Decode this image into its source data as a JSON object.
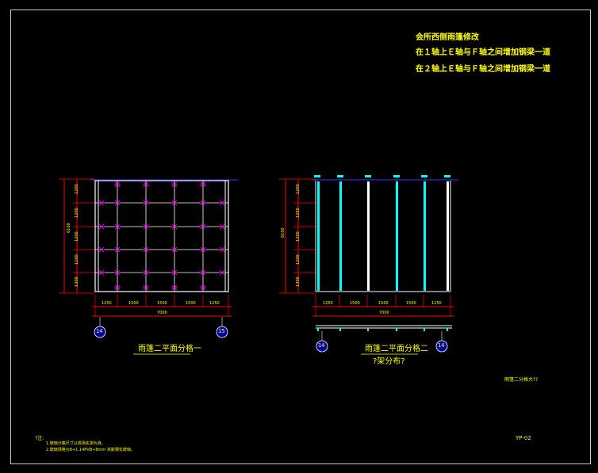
{
  "notes": {
    "line1": "会所西侧雨篷修改",
    "line2": "在１轴上Ｅ轴与Ｆ轴之间增加钢梁一道",
    "line3": "在２轴上Ｅ轴与Ｆ轴之间增加钢梁一道"
  },
  "plan1": {
    "title": "雨篷二平面分格一",
    "axis_left": "14",
    "axis_right": "15",
    "total_height": "6100",
    "left_dims": [
      "1200",
      "1200",
      "1200",
      "1200",
      "1300"
    ],
    "bottom_dims": [
      "1250",
      "1500",
      "1500",
      "1500",
      "1250"
    ],
    "total_width": "7000"
  },
  "plan2": {
    "title": "雨篷二平面分格二",
    "subtitle": "?架分布?",
    "axis_left": "14",
    "axis_right": "14",
    "total_height": "6100",
    "left_dims": [
      "1200",
      "1200",
      "1200",
      "1200",
      "1300"
    ],
    "bottom_dims": [
      "1250",
      "1500",
      "1500",
      "1500",
      "1250"
    ],
    "total_width": "7000"
  },
  "side_label": "雨篷二分格大??",
  "footnotes": {
    "head": "?注:",
    "line1": "1.玻璃分格尺寸以现场实测为准。",
    "line2": "2.玻璃规格为8+1.14PVB+8mm 夹胶钢化玻璃。"
  },
  "sheet_no": "YP-02",
  "colors": {
    "background": "#000000",
    "border": "#ffffff",
    "dimension": "#ff0000",
    "grid": "#ffffff",
    "node": "#ff00ff",
    "beam": "#00ffff",
    "axis_bubble": "#0000aa",
    "text": "#ffff00"
  }
}
